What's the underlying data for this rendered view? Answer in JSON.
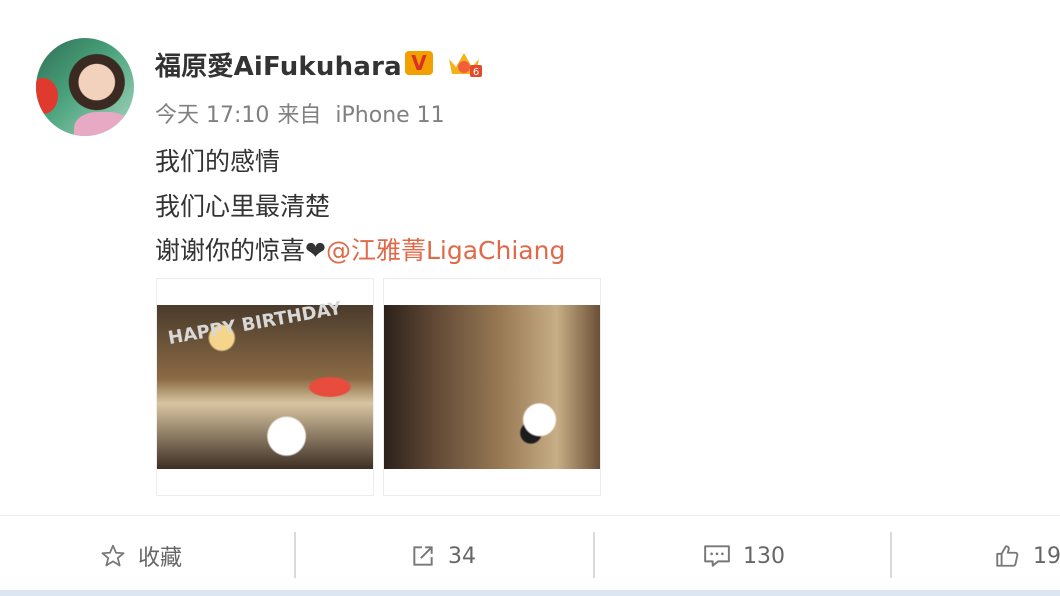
{
  "post": {
    "username": "福原愛AiFukuhara",
    "verified_badge": "V",
    "meta": {
      "time": "今天 17:10",
      "source_prefix": "来自",
      "device": "iPhone 11"
    },
    "lines": [
      "我们的感情",
      "我们心里最清楚"
    ],
    "line3_text": "谢谢你的惊喜",
    "heart": "❤",
    "mention": "@江雅菁LigaChiang",
    "photos": [
      {
        "banner_text": "HAPPY BIRTHDAY"
      },
      {
        "banner_text": ""
      }
    ]
  },
  "actions": {
    "favorite_label": "收藏",
    "repost_count": "34",
    "comment_count": "130",
    "like_count": "19"
  },
  "icons": [
    "avatar",
    "verified-v-icon",
    "member-crown-icon",
    "star-icon",
    "repost-icon",
    "comment-icon",
    "like-icon"
  ],
  "colors": {
    "mention": "#e0694a",
    "verified_badge": "#f2a000",
    "meta_text": "#808080"
  }
}
